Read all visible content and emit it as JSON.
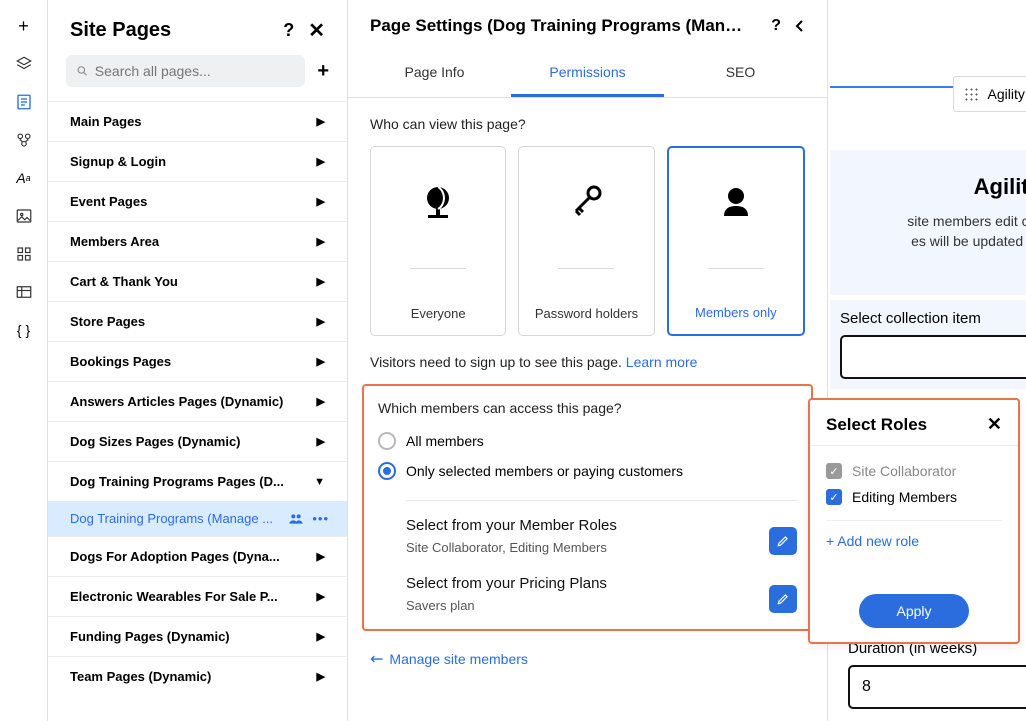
{
  "rail_icons": [
    {
      "name": "add-icon",
      "glyph": "+",
      "active": false
    },
    {
      "name": "layers-icon",
      "glyph": "◫",
      "active": false
    },
    {
      "name": "pages-icon",
      "glyph": "▤",
      "active": true
    },
    {
      "name": "users-icon",
      "glyph": "⚘",
      "active": false
    },
    {
      "name": "text-icon",
      "glyph": "Aᵅ",
      "active": false
    },
    {
      "name": "image-icon",
      "glyph": "🖼",
      "active": false
    },
    {
      "name": "apps-icon",
      "glyph": "▦",
      "active": false
    },
    {
      "name": "table-icon",
      "glyph": "▦",
      "active": false
    },
    {
      "name": "code-icon",
      "glyph": "{}",
      "active": false
    }
  ],
  "sidebar": {
    "title": "Site Pages",
    "search_placeholder": "Search all pages...",
    "groups": [
      {
        "label": "Main Pages",
        "open": false
      },
      {
        "label": "Signup & Login",
        "open": false
      },
      {
        "label": "Event Pages",
        "open": false
      },
      {
        "label": "Members Area",
        "open": false
      },
      {
        "label": "Cart & Thank You",
        "open": false
      },
      {
        "label": "Store Pages",
        "open": false
      },
      {
        "label": "Bookings Pages",
        "open": false
      },
      {
        "label": "Answers Articles Pages (Dynamic)",
        "open": false
      },
      {
        "label": "Dog Sizes Pages (Dynamic)",
        "open": false
      },
      {
        "label": "Dog Training Programs Pages (D...",
        "open": true,
        "children": [
          {
            "label": "Dog Training Programs (Manage ...",
            "selected": true
          }
        ]
      },
      {
        "label": "Dogs For Adoption Pages (Dyna...",
        "open": false
      },
      {
        "label": "Electronic Wearables For Sale P...",
        "open": false
      },
      {
        "label": "Funding Pages (Dynamic)",
        "open": false
      },
      {
        "label": "Team Pages (Dynamic)",
        "open": false
      }
    ]
  },
  "panel": {
    "title": "Page Settings (Dog Training Programs (Manage ...",
    "tabs": [
      {
        "label": "Page Info",
        "active": false
      },
      {
        "label": "Permissions",
        "active": true
      },
      {
        "label": "SEO",
        "active": false
      }
    ],
    "who_label": "Who can view this page?",
    "perm_options": [
      {
        "name": "everyone",
        "label": "Everyone",
        "selected": false
      },
      {
        "name": "password",
        "label": "Password holders",
        "selected": false
      },
      {
        "name": "members",
        "label": "Members only",
        "selected": true
      }
    ],
    "visitors_note": "Visitors need to sign up to see this page. ",
    "learn_more": "Learn more",
    "which_label": "Which members can access this page?",
    "radios": [
      {
        "label": "All members",
        "checked": false
      },
      {
        "label": "Only selected members or paying customers",
        "checked": true
      }
    ],
    "member_roles": {
      "title": "Select from your Member Roles",
      "value": "Site Collaborator, Editing Members"
    },
    "pricing_plans": {
      "title": "Select from your Pricing Plans",
      "value": "Savers plan"
    },
    "manage_link_icon": "↗",
    "manage_link": "Manage site members"
  },
  "canvas": {
    "chip_label": "Agility Tra",
    "heading": "Agility Tra",
    "subtext": "site members edit collection\nes will be updated in your c\nyo",
    "field1_label": "Select collection item",
    "field2_label": "Duration (in weeks)",
    "field2_value": "8"
  },
  "roles_popup": {
    "title": "Select Roles",
    "items": [
      {
        "label": "Site Collaborator",
        "checked": true,
        "disabled": true
      },
      {
        "label": "Editing Members",
        "checked": true,
        "disabled": false
      }
    ],
    "add_new": "+ Add new role",
    "apply": "Apply"
  }
}
